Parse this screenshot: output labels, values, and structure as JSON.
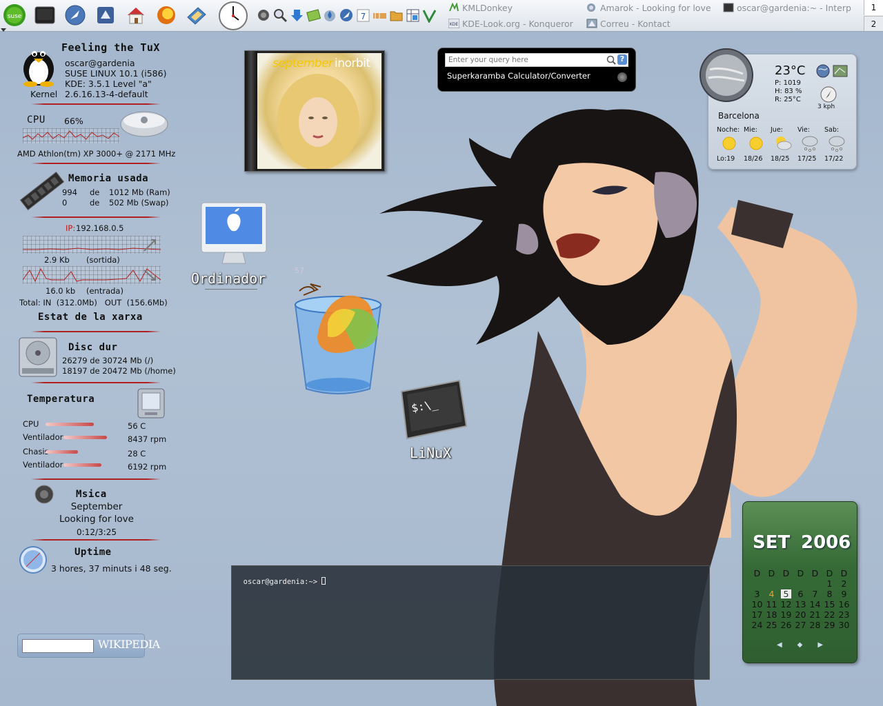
{
  "panel": {
    "launchers": [
      "suse-menu-icon",
      "terminal-icon",
      "konqueror-icon",
      "mail-icon",
      "home-icon",
      "firefox-icon",
      "bookmarks-icon",
      "clock-icon"
    ],
    "tray_icons": [
      "speaker-icon",
      "search-icon",
      "download-icon",
      "notes-icon",
      "drops-icon",
      "browser-icon",
      "calendar-7-icon",
      "network-icon",
      "folder-icon",
      "spreadsheet-icon",
      "vector-icon"
    ],
    "tasks": [
      {
        "label": "KMLDonkey",
        "icon": "donkey-icon"
      },
      {
        "label": "KDE-Look.org - Konqueror",
        "icon": "kdelook-icon"
      },
      {
        "label": "Amarok - Looking for love",
        "icon": "amarok-icon"
      },
      {
        "label": "Correu - Kontact",
        "icon": "kontact-icon"
      },
      {
        "label": "oscar@gardenia:~ - Interp",
        "icon": "konsole-icon"
      }
    ],
    "pager": [
      "1",
      "2"
    ]
  },
  "sysinfo": {
    "title": "Feeling the TuX",
    "user": "oscar@gardenia",
    "os": "SUSE LINUX 10.1 (i586)",
    "kde": "KDE: 3.5.1 Level \"a\"",
    "kernel_label": "Kernel",
    "kernel": "2.6.16.13-4-default"
  },
  "cpu": {
    "label": "CPU",
    "percent": "66%",
    "model": "AMD Athlon(tm) XP 3000+ @ 2171 MHz"
  },
  "memory": {
    "title": "Memoria usada",
    "ram": {
      "used": "994",
      "of": "de",
      "total": "1012 Mb (Ram)"
    },
    "swap": {
      "used": "0",
      "of": "de",
      "total": "502 Mb (Swap)"
    }
  },
  "network": {
    "ip_label": "IP:",
    "ip": "192.168.0.5",
    "out_rate": "2.9 Kb",
    "out_label": "(sortida)",
    "in_rate": "16.0 kb",
    "in_label": "(entrada)",
    "total": "Total: IN  (312.0Mb)   OUT  (156.6Mb)",
    "title": "Estat de la xarxa"
  },
  "disk": {
    "title": "Disc dur",
    "root": "26279 de 30724 Mb (/)",
    "home": "18197 de 20472 Mb (/home)"
  },
  "temperature": {
    "title": "Temperatura",
    "rows": [
      {
        "label": "CPU",
        "value": "56 C",
        "level": 0.78
      },
      {
        "label": "Ventilador",
        "value": "8437 rpm",
        "level": 0.9
      },
      {
        "label": "Chasis",
        "value": "28 C",
        "level": 0.52
      },
      {
        "label": "Ventilador",
        "value": "6192 rpm",
        "level": 0.78
      }
    ]
  },
  "music": {
    "title": "Msica",
    "artist": "September",
    "song": "Looking for love",
    "time": "0:12/3:25"
  },
  "uptime": {
    "title": "Uptime",
    "value": "3 hores, 37 minuts i 48 seg."
  },
  "album": {
    "artist_text": "september",
    "album_text": "inorbit"
  },
  "desktop": {
    "computer": "Ordinador",
    "trash_count": "57",
    "linux": "LiNuX"
  },
  "query": {
    "placeholder": "Enter your query here",
    "title": "Superkaramba Calculator/Converter"
  },
  "weather": {
    "temp": "23°C",
    "pressure": "P: 1019",
    "humidity": "H: 83 %",
    "real": "R: 25°C",
    "wind": "3 kph",
    "city": "Barcelona",
    "days": [
      {
        "day": "Noche:",
        "temps": "Lo:19",
        "icon": "sun-icon"
      },
      {
        "day": "Mie:",
        "temps": "18/26",
        "icon": "sun-icon"
      },
      {
        "day": "Jue:",
        "temps": "18/25",
        "icon": "partly-cloudy-icon"
      },
      {
        "day": "Vie:",
        "temps": "17/25",
        "icon": "snow-cloud-icon"
      },
      {
        "day": "Sab:",
        "temps": "17/22",
        "icon": "snow-cloud-icon"
      }
    ]
  },
  "terminal": {
    "prompt": "oscar@gardenia:~> "
  },
  "calendar": {
    "month": "SET",
    "year": "2006",
    "header": [
      "D",
      "D",
      "D",
      "D",
      "D",
      "D",
      "D"
    ],
    "weeks": [
      [
        "",
        "",
        "",
        "",
        "",
        "1",
        "2"
      ],
      [
        "3",
        "4",
        "5",
        "6",
        "7",
        "8",
        "9"
      ],
      [
        "10",
        "11",
        "12",
        "13",
        "14",
        "15",
        "16"
      ],
      [
        "17",
        "18",
        "19",
        "20",
        "21",
        "22",
        "23"
      ],
      [
        "24",
        "25",
        "26",
        "27",
        "28",
        "29",
        "30"
      ]
    ],
    "today": "5",
    "marked": "4",
    "nav": [
      "◀",
      "◆",
      "▶"
    ]
  },
  "wikipedia": {
    "logo": "WIKIPEDIA"
  }
}
